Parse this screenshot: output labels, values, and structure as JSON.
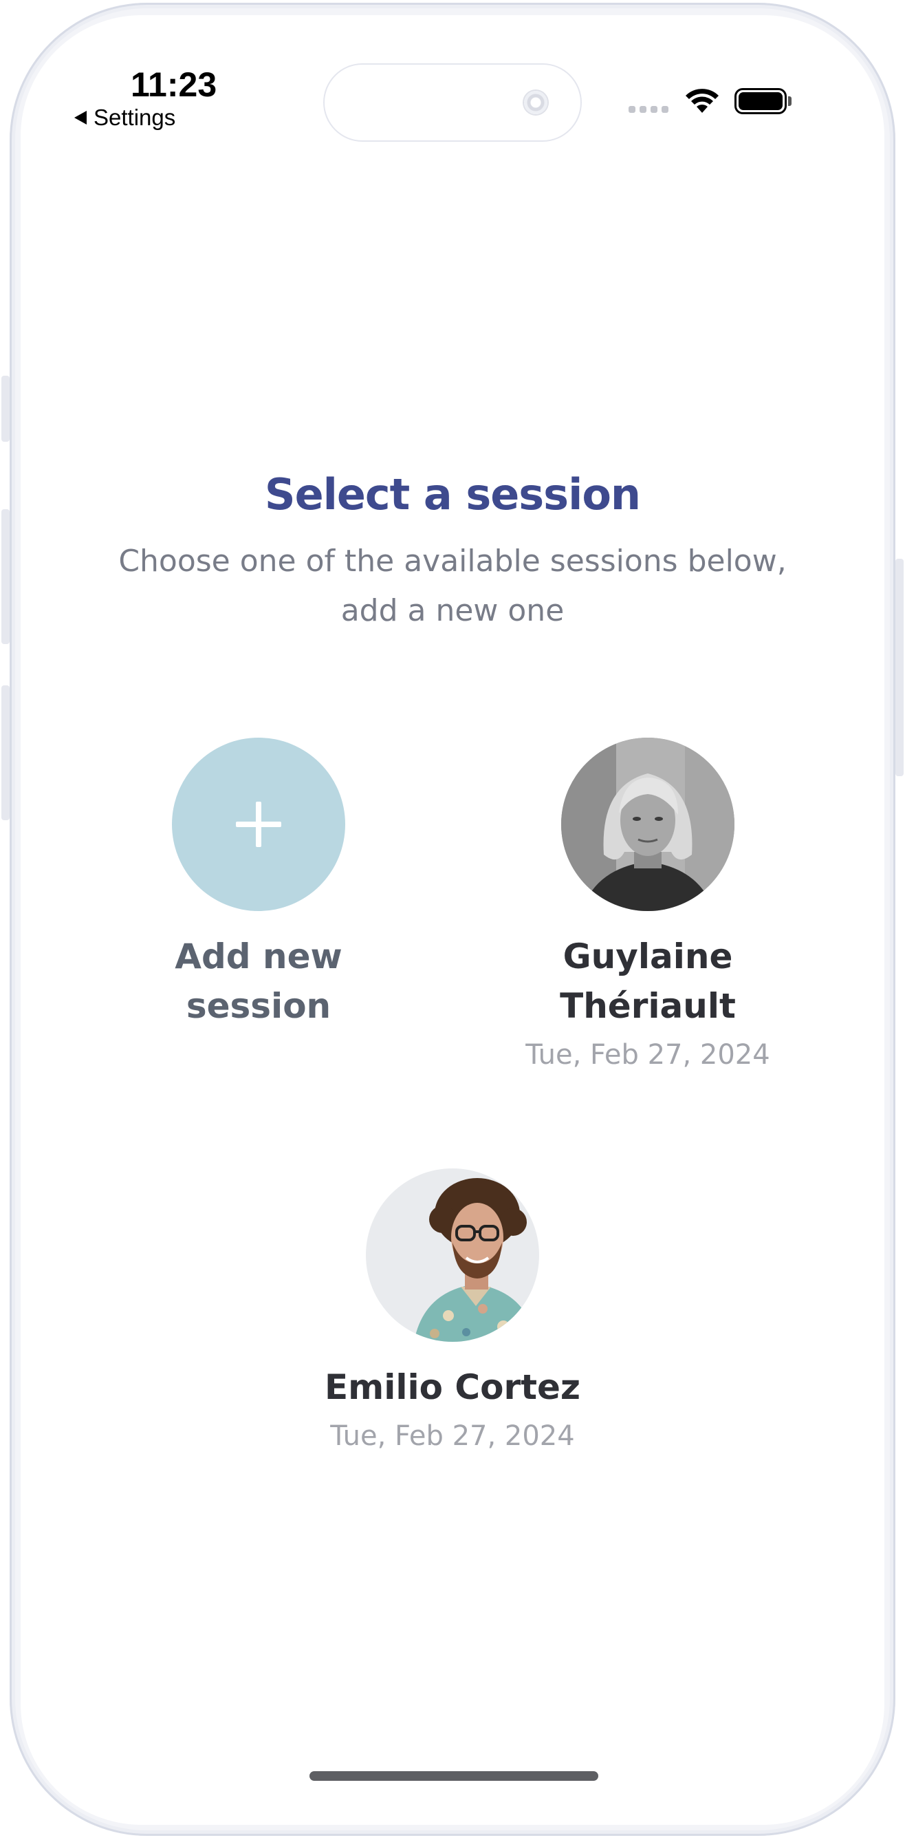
{
  "status_bar": {
    "time": "11:23",
    "back_label": "Settings"
  },
  "header": {
    "title": "Select a session",
    "subtitle": "Choose one of the available sessions below, add a new one"
  },
  "add_session": {
    "label": "Add new session",
    "icon": "plus-icon",
    "color": "#b9d7e1"
  },
  "sessions": [
    {
      "name": "Guylaine Thériault",
      "date": "Tue, Feb 27, 2024"
    },
    {
      "name": "Emilio Cortez",
      "date": "Tue, Feb 27, 2024"
    }
  ],
  "colors": {
    "title": "#3e4a8e",
    "subtitle": "#787c88",
    "name": "#2f3036",
    "date": "#a2a4ab"
  }
}
